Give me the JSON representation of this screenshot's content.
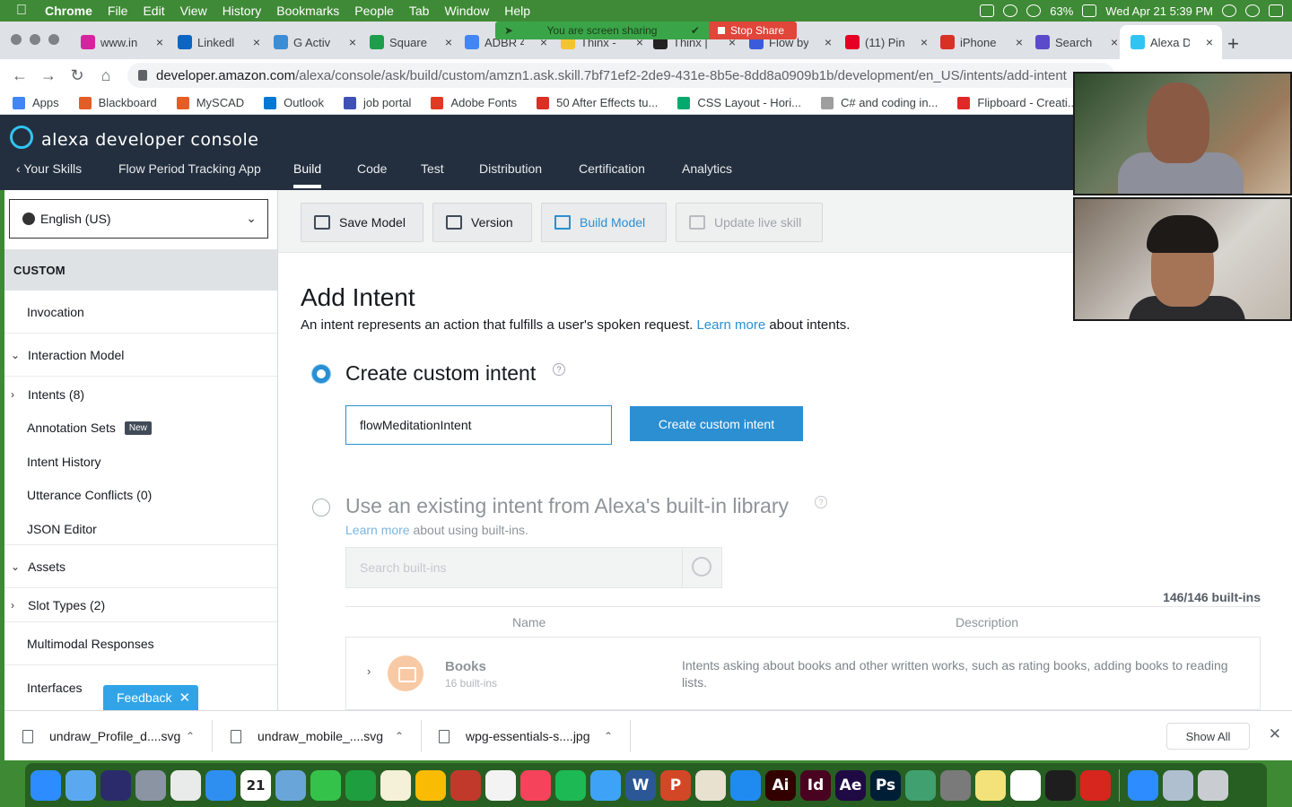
{
  "menubar": {
    "app": "Chrome",
    "items": [
      "File",
      "Edit",
      "View",
      "History",
      "Bookmarks",
      "People",
      "Tab",
      "Window",
      "Help"
    ],
    "battery": "63%",
    "datetime": "Wed Apr 21  5:39 PM"
  },
  "screen_share": {
    "status": "You are screen sharing",
    "stop": "Stop Share"
  },
  "tabs": [
    {
      "label": "www.in",
      "color": "#d6249f"
    },
    {
      "label": "Linkedl",
      "color": "#0a66c2"
    },
    {
      "label": "G Activ",
      "color": "#3b8ed6"
    },
    {
      "label": "Square",
      "color": "#1e9e4a"
    },
    {
      "label": "ADBR 4",
      "color": "#4285f4"
    },
    {
      "label": "Thinx -",
      "color": "#f4c430"
    },
    {
      "label": "Thinx |",
      "color": "#222222"
    },
    {
      "label": "Flow by",
      "color": "#3b5bdb"
    },
    {
      "label": "(11) Pin",
      "color": "#e60023"
    },
    {
      "label": "iPhone",
      "color": "#d93025"
    },
    {
      "label": "Search",
      "color": "#5b4bcb"
    },
    {
      "label": "Alexa D",
      "color": "#31c4f3"
    }
  ],
  "address": {
    "host": "developer.amazon.com",
    "path": "/alexa/console/ask/build/custom/amzn1.ask.skill.7bf71ef2-2de9-431e-8b5e-8dd8a0909b1b/development/en_US/intents/add-intent"
  },
  "bookmarks": [
    {
      "label": "Apps",
      "color": "#4285f4"
    },
    {
      "label": "Blackboard",
      "color": "#e35d26"
    },
    {
      "label": "MySCAD",
      "color": "#e35d26"
    },
    {
      "label": "Outlook",
      "color": "#0078d4"
    },
    {
      "label": "job portal",
      "color": "#3f51b5"
    },
    {
      "label": "Adobe Fonts",
      "color": "#e03b22"
    },
    {
      "label": "50 After Effects tu...",
      "color": "#d93025"
    },
    {
      "label": "CSS Layout - Hori...",
      "color": "#04aa6d"
    },
    {
      "label": "C# and coding in...",
      "color": "#9e9e9e"
    },
    {
      "label": "Flipboard - Creati...",
      "color": "#e12828"
    }
  ],
  "alexa": {
    "brand": "alexa developer console",
    "nav": {
      "your_skills": "Your Skills",
      "skill_name": "Flow Period Tracking App",
      "build": "Build",
      "code": "Code",
      "test": "Test",
      "distribution": "Distribution",
      "certification": "Certification",
      "analytics": "Analytics"
    }
  },
  "sidebar": {
    "locale": "English (US)",
    "section": "CUSTOM",
    "invocation": "Invocation",
    "interaction_model": "Interaction Model",
    "intents": "Intents (8)",
    "annotation_sets": "Annotation Sets",
    "new_badge": "New",
    "intent_history": "Intent History",
    "utterance_conflicts": "Utterance Conflicts (0)",
    "json_editor": "JSON Editor",
    "assets": "Assets",
    "slot_types": "Slot Types (2)",
    "multimodal": "Multimodal Responses",
    "interfaces": "Interfaces",
    "feedback": "Feedback"
  },
  "actions": {
    "save": "Save Model",
    "version": "Version",
    "build": "Build Model",
    "update": "Update live skill"
  },
  "page": {
    "title": "Add Intent",
    "desc_pre": "An intent represents an action that fulfills a user's spoken request. ",
    "desc_link": "Learn more",
    "desc_post": " about intents.",
    "option1": "Create custom intent",
    "intent_value": "flowMeditationIntent",
    "create_button": "Create custom intent",
    "option2": "Use an existing intent from Alexa's built-in library",
    "option2_link": "Learn more",
    "option2_post": " about using built-ins.",
    "search_placeholder": "Search built-ins",
    "count": "146/146 built-ins",
    "col_name": "Name",
    "col_desc": "Description",
    "row": {
      "title": "Books",
      "subtitle": "16 built-ins",
      "description": "Intents asking about books and other written works, such as rating books, adding books to reading lists."
    }
  },
  "downloads": {
    "files": [
      "undraw_Profile_d....svg",
      "undraw_mobile_....svg",
      "wpg-essentials-s....jpg"
    ],
    "show_all": "Show All"
  },
  "dock": [
    {
      "name": "zoom-app",
      "color": "#2d8cff",
      "label": ""
    },
    {
      "name": "finder",
      "color": "#5aa9f0",
      "label": ""
    },
    {
      "name": "siri",
      "color": "#2b2b6b",
      "label": ""
    },
    {
      "name": "launchpad",
      "color": "#8a94a3",
      "label": ""
    },
    {
      "name": "chrome",
      "color": "#e9eaea",
      "label": ""
    },
    {
      "name": "safari",
      "color": "#2f8ff0",
      "label": ""
    },
    {
      "name": "calendar",
      "color": "#ffffff",
      "label": "21"
    },
    {
      "name": "preview",
      "color": "#6aa5d9",
      "label": ""
    },
    {
      "name": "facetime",
      "color": "#35c24a",
      "label": ""
    },
    {
      "name": "evernote",
      "color": "#1f9e3f",
      "label": ""
    },
    {
      "name": "notes",
      "color": "#f5f0d8",
      "label": ""
    },
    {
      "name": "google-keep",
      "color": "#f9bb04",
      "label": ""
    },
    {
      "name": "photo-booth",
      "color": "#c0392b",
      "label": ""
    },
    {
      "name": "photos",
      "color": "#f3f3f3",
      "label": ""
    },
    {
      "name": "music",
      "color": "#f5435c",
      "label": ""
    },
    {
      "name": "spotify",
      "color": "#1db954",
      "label": ""
    },
    {
      "name": "messages",
      "color": "#3ea2f7",
      "label": ""
    },
    {
      "name": "word",
      "color": "#2b5797",
      "label": "W"
    },
    {
      "name": "powerpoint",
      "color": "#d24726",
      "label": "P"
    },
    {
      "name": "preview-2",
      "color": "#e8e1d0",
      "label": ""
    },
    {
      "name": "app-store",
      "color": "#1f8bf0",
      "label": ""
    },
    {
      "name": "illustrator",
      "color": "#330000",
      "label": "Ai"
    },
    {
      "name": "indesign",
      "color": "#49021f",
      "label": "Id"
    },
    {
      "name": "after-effects",
      "color": "#1f0a44",
      "label": "Ae"
    },
    {
      "name": "photoshop",
      "color": "#001e36",
      "label": "Ps"
    },
    {
      "name": "atom",
      "color": "#40a070",
      "label": ""
    },
    {
      "name": "system-preferences",
      "color": "#7a7a7a",
      "label": ""
    },
    {
      "name": "stickies",
      "color": "#f3e27a",
      "label": ""
    },
    {
      "name": "slack",
      "color": "#ffffff",
      "label": ""
    },
    {
      "name": "figma",
      "color": "#1e1e1e",
      "label": ""
    },
    {
      "name": "acrobat",
      "color": "#d7261e",
      "label": ""
    },
    {
      "name": "zoom",
      "color": "#2d8cff",
      "label": ""
    },
    {
      "name": "image-capture",
      "color": "#b0bfcf",
      "label": ""
    },
    {
      "name": "trash",
      "color": "#c9cdd2",
      "label": ""
    }
  ]
}
